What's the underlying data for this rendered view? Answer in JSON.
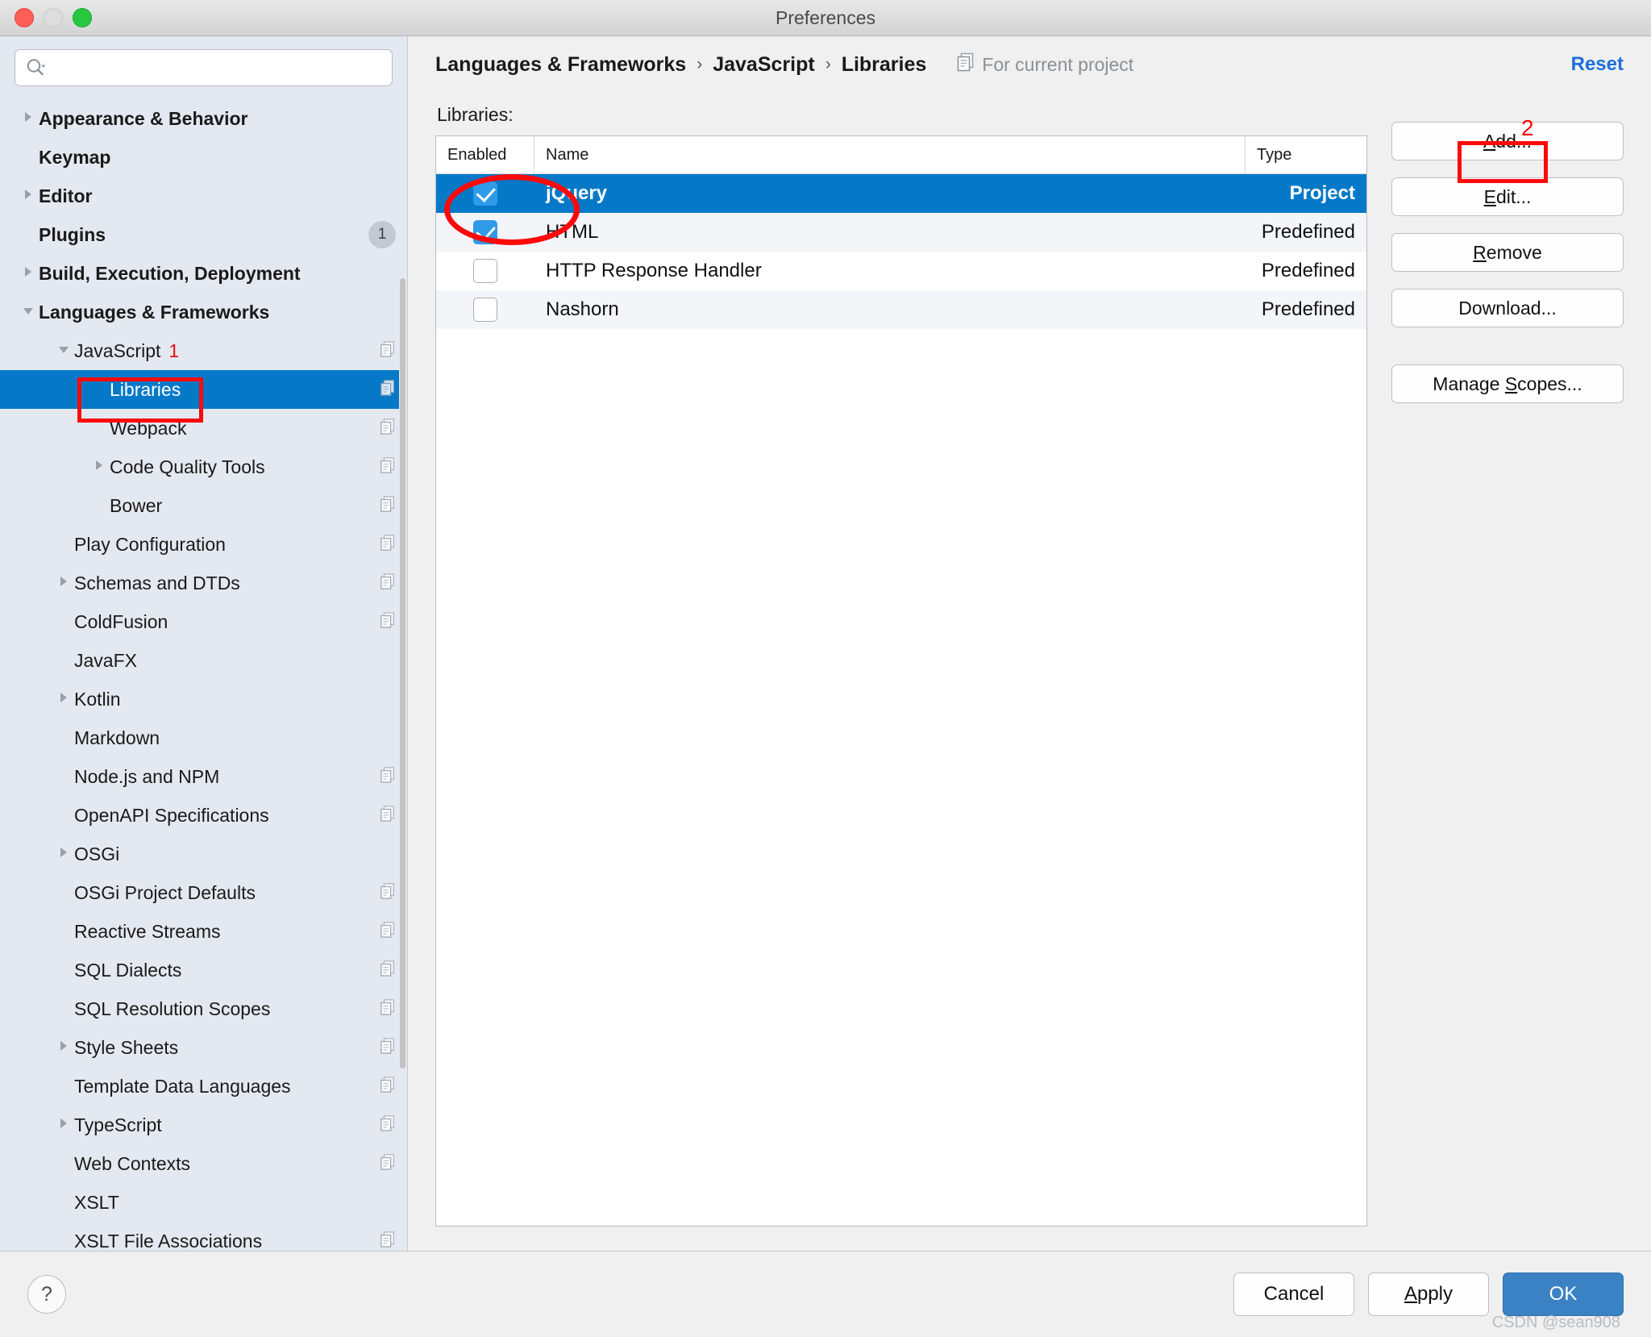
{
  "window": {
    "title": "Preferences",
    "traffic_lights": [
      "close",
      "minimize",
      "zoom"
    ]
  },
  "sidebar": {
    "search": {
      "value": "",
      "placeholder": ""
    },
    "items": [
      {
        "label": "Appearance & Behavior",
        "level": 0,
        "arrow": "right",
        "copy": false,
        "badge": null,
        "mark": null,
        "selected": false
      },
      {
        "label": "Keymap",
        "level": 0,
        "arrow": "none",
        "copy": false,
        "badge": null,
        "mark": null,
        "selected": false
      },
      {
        "label": "Editor",
        "level": 0,
        "arrow": "right",
        "copy": false,
        "badge": null,
        "mark": null,
        "selected": false
      },
      {
        "label": "Plugins",
        "level": 0,
        "arrow": "none",
        "copy": false,
        "badge": "1",
        "mark": null,
        "selected": false
      },
      {
        "label": "Build, Execution, Deployment",
        "level": 0,
        "arrow": "right",
        "copy": false,
        "badge": null,
        "mark": null,
        "selected": false
      },
      {
        "label": "Languages & Frameworks",
        "level": 0,
        "arrow": "down",
        "copy": false,
        "badge": null,
        "mark": null,
        "selected": false
      },
      {
        "label": "JavaScript",
        "level": 1,
        "arrow": "down",
        "copy": true,
        "badge": null,
        "mark": "1",
        "selected": false
      },
      {
        "label": "Libraries",
        "level": 2,
        "arrow": "none",
        "copy": true,
        "badge": null,
        "mark": null,
        "selected": true
      },
      {
        "label": "Webpack",
        "level": 2,
        "arrow": "none",
        "copy": true,
        "badge": null,
        "mark": null,
        "selected": false
      },
      {
        "label": "Code Quality Tools",
        "level": 2,
        "arrow": "right",
        "copy": true,
        "badge": null,
        "mark": null,
        "selected": false
      },
      {
        "label": "Bower",
        "level": 2,
        "arrow": "none",
        "copy": true,
        "badge": null,
        "mark": null,
        "selected": false
      },
      {
        "label": "Play Configuration",
        "level": 1,
        "arrow": "none",
        "copy": true,
        "badge": null,
        "mark": null,
        "selected": false
      },
      {
        "label": "Schemas and DTDs",
        "level": 1,
        "arrow": "right",
        "copy": true,
        "badge": null,
        "mark": null,
        "selected": false
      },
      {
        "label": "ColdFusion",
        "level": 1,
        "arrow": "none",
        "copy": true,
        "badge": null,
        "mark": null,
        "selected": false
      },
      {
        "label": "JavaFX",
        "level": 1,
        "arrow": "none",
        "copy": false,
        "badge": null,
        "mark": null,
        "selected": false
      },
      {
        "label": "Kotlin",
        "level": 1,
        "arrow": "right",
        "copy": false,
        "badge": null,
        "mark": null,
        "selected": false
      },
      {
        "label": "Markdown",
        "level": 1,
        "arrow": "none",
        "copy": false,
        "badge": null,
        "mark": null,
        "selected": false
      },
      {
        "label": "Node.js and NPM",
        "level": 1,
        "arrow": "none",
        "copy": true,
        "badge": null,
        "mark": null,
        "selected": false
      },
      {
        "label": "OpenAPI Specifications",
        "level": 1,
        "arrow": "none",
        "copy": true,
        "badge": null,
        "mark": null,
        "selected": false
      },
      {
        "label": "OSGi",
        "level": 1,
        "arrow": "right",
        "copy": false,
        "badge": null,
        "mark": null,
        "selected": false
      },
      {
        "label": "OSGi Project Defaults",
        "level": 1,
        "arrow": "none",
        "copy": true,
        "badge": null,
        "mark": null,
        "selected": false
      },
      {
        "label": "Reactive Streams",
        "level": 1,
        "arrow": "none",
        "copy": true,
        "badge": null,
        "mark": null,
        "selected": false
      },
      {
        "label": "SQL Dialects",
        "level": 1,
        "arrow": "none",
        "copy": true,
        "badge": null,
        "mark": null,
        "selected": false
      },
      {
        "label": "SQL Resolution Scopes",
        "level": 1,
        "arrow": "none",
        "copy": true,
        "badge": null,
        "mark": null,
        "selected": false
      },
      {
        "label": "Style Sheets",
        "level": 1,
        "arrow": "right",
        "copy": true,
        "badge": null,
        "mark": null,
        "selected": false
      },
      {
        "label": "Template Data Languages",
        "level": 1,
        "arrow": "none",
        "copy": true,
        "badge": null,
        "mark": null,
        "selected": false
      },
      {
        "label": "TypeScript",
        "level": 1,
        "arrow": "right",
        "copy": true,
        "badge": null,
        "mark": null,
        "selected": false
      },
      {
        "label": "Web Contexts",
        "level": 1,
        "arrow": "none",
        "copy": true,
        "badge": null,
        "mark": null,
        "selected": false
      },
      {
        "label": "XSLT",
        "level": 1,
        "arrow": "none",
        "copy": false,
        "badge": null,
        "mark": null,
        "selected": false
      },
      {
        "label": "XSLT File Associations",
        "level": 1,
        "arrow": "none",
        "copy": true,
        "badge": null,
        "mark": null,
        "selected": false
      }
    ]
  },
  "header": {
    "breadcrumb": [
      "Languages & Frameworks",
      "JavaScript",
      "Libraries"
    ],
    "separator": "›",
    "scope_label": "For current project",
    "reset_label": "Reset"
  },
  "main": {
    "section_label": "Libraries:",
    "table": {
      "columns": [
        "Enabled",
        "Name",
        "Type"
      ],
      "rows": [
        {
          "enabled": true,
          "name": "jQuery",
          "type": "Project",
          "selected": true
        },
        {
          "enabled": true,
          "name": "HTML",
          "type": "Predefined",
          "selected": false
        },
        {
          "enabled": false,
          "name": "HTTP Response Handler",
          "type": "Predefined",
          "selected": false
        },
        {
          "enabled": false,
          "name": "Nashorn",
          "type": "Predefined",
          "selected": false
        }
      ]
    },
    "buttons": [
      {
        "label": "Add...",
        "mnemonic": "A"
      },
      {
        "label": "Edit...",
        "mnemonic": "E"
      },
      {
        "label": "Remove",
        "mnemonic": "R"
      },
      {
        "label": "Download...",
        "mnemonic": ""
      },
      {
        "label": "Manage Scopes...",
        "mnemonic": "S"
      }
    ]
  },
  "footer": {
    "help_label": "?",
    "cancel_label": "Cancel",
    "apply_label": "Apply",
    "apply_mnemonic": "A",
    "ok_label": "OK",
    "watermark": "CSDN @sean908"
  },
  "annotations": [
    {
      "id": "step1-libraries",
      "shape": "box",
      "number": null
    },
    {
      "id": "step1-number",
      "shape": "number",
      "number": "1"
    },
    {
      "id": "step2-add",
      "shape": "box",
      "number": null
    },
    {
      "id": "step2-number",
      "shape": "number",
      "number": "2"
    },
    {
      "id": "jquery-circle",
      "shape": "ellipse",
      "number": null
    }
  ],
  "colors": {
    "selection_blue": "#0579c8",
    "annotation_red": "#fb0a0a",
    "link_blue": "#1e6fd9",
    "ok_blue": "#3b82c4",
    "sidebar_bg": "#e4e8f0"
  }
}
